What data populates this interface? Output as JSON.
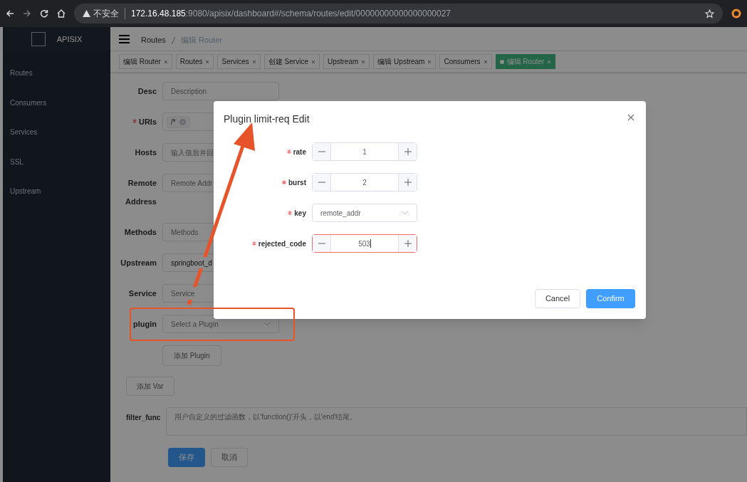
{
  "browser": {
    "security": "不安全",
    "url_host": "172.16.48.185",
    "url_rest": ":9080/apisix/dashboard#/schema/routes/edit/00000000000000000027"
  },
  "sidebar": {
    "brand": "APISIX",
    "items": [
      "Routes",
      "Consumers",
      "Services",
      "SSL",
      "Upstream"
    ]
  },
  "breadcrumb": [
    "Routes",
    "编辑 Router"
  ],
  "tabs": [
    {
      "label": "编辑 Router",
      "selected": false
    },
    {
      "label": "Routes",
      "selected": false
    },
    {
      "label": "Services",
      "selected": false
    },
    {
      "label": "创建 Service",
      "selected": false
    },
    {
      "label": "Upstream",
      "selected": false
    },
    {
      "label": "编辑 Upstream",
      "selected": false
    },
    {
      "label": "Consumers",
      "selected": false
    },
    {
      "label": "编辑 Router",
      "selected": true
    }
  ],
  "form": {
    "fields": [
      {
        "label": "Desc",
        "required": false,
        "kind": "input",
        "placeholder": "Description"
      },
      {
        "label": "URIs",
        "required": true,
        "kind": "tags",
        "tags": [
          "/*"
        ]
      },
      {
        "label": "Hosts",
        "required": false,
        "kind": "input",
        "placeholder": "输入值后并回"
      },
      {
        "label": "Remote Address",
        "required": false,
        "kind": "input",
        "placeholder": "Remote Addr"
      },
      {
        "label": "Methods",
        "required": false,
        "kind": "input",
        "placeholder": "Methods"
      },
      {
        "label": "Upstream",
        "required": false,
        "kind": "input",
        "value": "springboot_d"
      },
      {
        "label": "Service",
        "required": false,
        "kind": "input",
        "placeholder": "Service"
      },
      {
        "label": "plugin",
        "required": false,
        "kind": "select",
        "placeholder": "Select a Plugin"
      }
    ],
    "add_plugin": "添加 Plugin",
    "add_var": "添加 Var",
    "filter_func": {
      "label": "filter_func",
      "placeholder": "用户自定义的过滤函数，以'function()'开头，以'end'结尾。"
    },
    "save": "保存",
    "cancel": "取消"
  },
  "modal": {
    "title": "Plugin limit-req Edit",
    "fields": [
      {
        "label": "rate",
        "required": true,
        "kind": "stepper",
        "value": "1",
        "error": false
      },
      {
        "label": "burst",
        "required": true,
        "kind": "stepper",
        "value": "2",
        "error": false
      },
      {
        "label": "key",
        "required": true,
        "kind": "select",
        "value": "remote_addr",
        "error": false
      },
      {
        "label": "rejected_code",
        "required": true,
        "kind": "stepper",
        "value": "503",
        "error": true
      }
    ],
    "cancel": "Cancel",
    "confirm": "Confirm"
  }
}
